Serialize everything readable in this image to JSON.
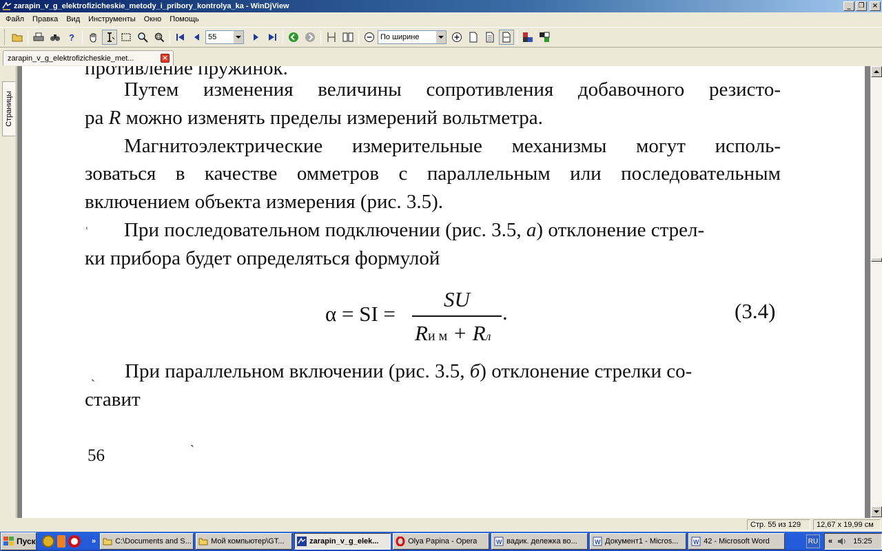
{
  "window": {
    "title": "zarapin_v_g_elektrofizicheskie_metody_i_pribory_kontrolya_ka - WinDjView",
    "minimize": "_",
    "restore": "❐",
    "close": "×"
  },
  "menu": {
    "items": [
      "Файл",
      "Правка",
      "Вид",
      "Инструменты",
      "Окно",
      "Помощь"
    ]
  },
  "toolbar": {
    "page_number": "55",
    "zoom": "По ширине"
  },
  "tab": {
    "label": "zarapin_v_g_elektrofizicheskie_met..."
  },
  "sidepanel": {
    "pages_tab": "Страницы"
  },
  "document": {
    "cut_line": "противление пружинок.",
    "lines": [
      "Путем изменения величины сопротивления добавочного резисто-",
      "ра ",
      "R",
      " можно изменять пределы измерений вольтметра.",
      "Магнитоэлектрические измерительные механизмы могут исполь-",
      "зоваться в качестве омметров с параллельным или последовательным",
      "включением объекта измерения (рис. 3.5).",
      "При последовательном подключении (рис. 3.5, ",
      "а",
      ") отклонение стрел-",
      "ки прибора будет определяться формулой",
      "При параллельном включении (рис. 3.5, ",
      "б",
      ") отклонение стрелки со-",
      "ставит"
    ],
    "formula": {
      "lhs": "α = SI =",
      "numerator": "SU",
      "den_r1": "R",
      "den_sub1": "и м",
      "den_plus": "+ R",
      "den_sub2": "л",
      "dot": ".",
      "number": "(3.4)"
    },
    "page_number": "56"
  },
  "status": {
    "page": "Стр. 55 из 129",
    "size": "12,67 x 19,99 см"
  },
  "taskbar": {
    "start": "Пуск",
    "more": "»",
    "tasks": [
      "C:\\Documents and S...",
      "Мой компьютер\\GT...",
      "zarapin_v_g_elek...",
      "Olya Papina - Opera",
      "вадик. дележка во...",
      "Документ1 - Micros...",
      "42 - Microsoft Word"
    ],
    "lang": "RU",
    "tray_more": "«",
    "clock": "15:25"
  }
}
